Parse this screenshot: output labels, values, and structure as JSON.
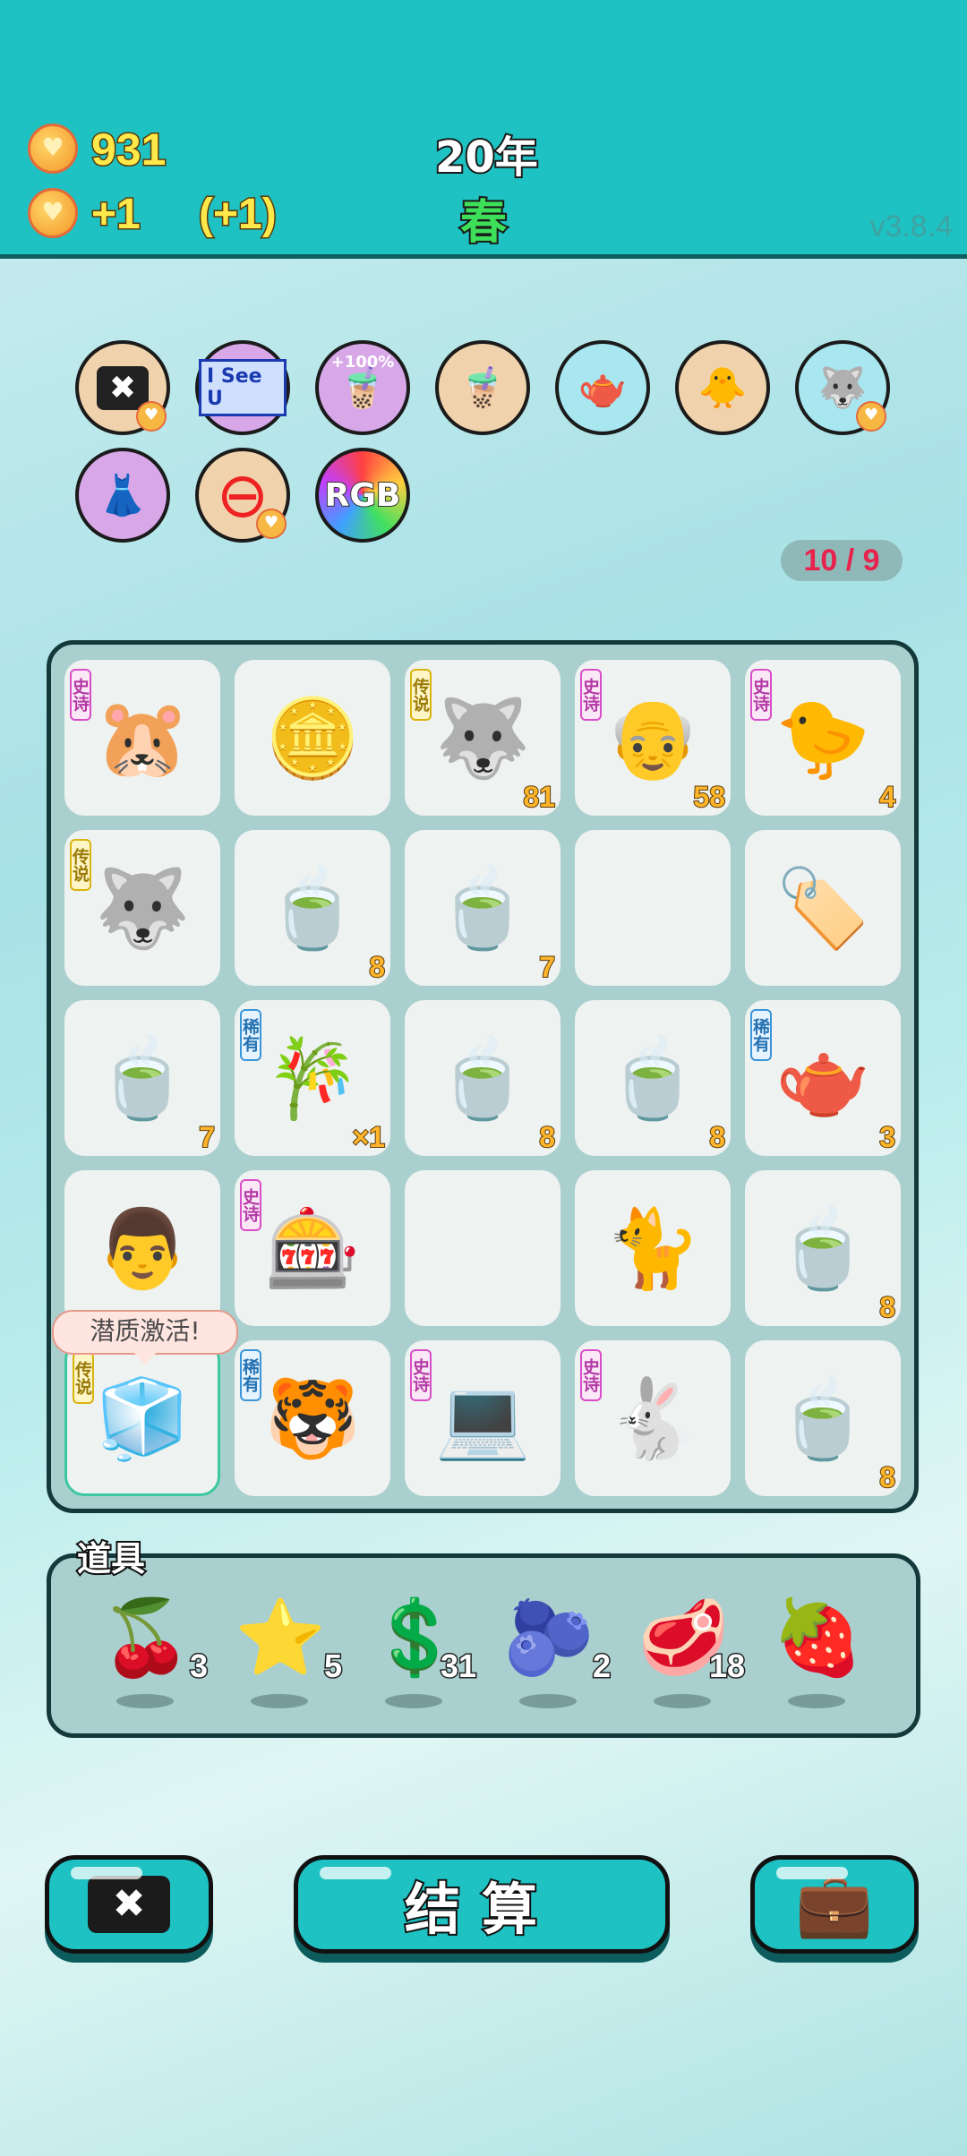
{
  "header": {
    "coins": "931",
    "income": "+1",
    "income_bonus": "(+1)",
    "year": "20年",
    "season": "春",
    "version": "v3.8.4"
  },
  "relics": [
    {
      "name": "remove-tag",
      "bg": "#f0d3ac",
      "glyph": "✖",
      "badge": true
    },
    {
      "name": "i-see-u",
      "bg": "#d8a7e8",
      "glyph": "I See U",
      "badge": false
    },
    {
      "name": "bubble-tea-100",
      "bg": "#d8a7e8",
      "glyph": "🧋",
      "label": "+100%",
      "badge": false
    },
    {
      "name": "bubble-tea",
      "bg": "#f0d3ac",
      "glyph": "🧋",
      "badge": false
    },
    {
      "name": "gravy-boat",
      "bg": "#a8e6f0",
      "glyph": "🫖",
      "badge": false
    },
    {
      "name": "chick-egg",
      "bg": "#f0d3ac",
      "glyph": "🐥",
      "badge": false
    },
    {
      "name": "husky",
      "bg": "#a8e6f0",
      "glyph": "🐺",
      "badge": true
    },
    {
      "name": "skirt",
      "bg": "#d8a7e8",
      "glyph": "👗",
      "badge": false
    },
    {
      "name": "minus",
      "bg": "#f0d3ac",
      "glyph": "⊖",
      "badge": true
    },
    {
      "name": "rgb",
      "bg": "#ff6a6a",
      "glyph": "RGB",
      "badge": false
    }
  ],
  "counter": "10 / 9",
  "board": [
    [
      {
        "icon": "🐹",
        "tag": "史诗",
        "tagType": "epic",
        "count": ""
      },
      {
        "icon": "🪙",
        "tag": "",
        "tagType": "",
        "count": ""
      },
      {
        "icon": "🐺",
        "tag": "传说",
        "tagType": "legend",
        "count": "81"
      },
      {
        "icon": "👴",
        "tag": "史诗",
        "tagType": "epic",
        "count": "58"
      },
      {
        "icon": "🐤",
        "tag": "史诗",
        "tagType": "epic",
        "count": "4"
      }
    ],
    [
      {
        "icon": "🐺",
        "tag": "传说",
        "tagType": "legend",
        "count": ""
      },
      {
        "icon": "🍵",
        "tag": "",
        "tagType": "",
        "count": "8"
      },
      {
        "icon": "🍵",
        "tag": "",
        "tagType": "",
        "count": "7"
      },
      {
        "icon": "",
        "tag": "",
        "tagType": "",
        "count": ""
      },
      {
        "icon": "🏷️",
        "tag": "",
        "tagType": "",
        "count": ""
      }
    ],
    [
      {
        "icon": "🍵",
        "tag": "",
        "tagType": "",
        "count": "7"
      },
      {
        "icon": "🎋",
        "tag": "稀有",
        "tagType": "rare",
        "count": "×1"
      },
      {
        "icon": "🍵",
        "tag": "",
        "tagType": "",
        "count": "8"
      },
      {
        "icon": "🍵",
        "tag": "",
        "tagType": "",
        "count": "8"
      },
      {
        "icon": "🫖",
        "tag": "稀有",
        "tagType": "rare",
        "count": "3"
      }
    ],
    [
      {
        "icon": "👨",
        "tag": "",
        "tagType": "",
        "count": ""
      },
      {
        "icon": "🎰",
        "tag": "史诗",
        "tagType": "epic",
        "count": ""
      },
      {
        "icon": "",
        "tag": "",
        "tagType": "",
        "count": ""
      },
      {
        "icon": "🐈",
        "tag": "",
        "tagType": "",
        "count": ""
      },
      {
        "icon": "🍵",
        "tag": "",
        "tagType": "",
        "count": "8"
      }
    ],
    [
      {
        "icon": "🧊",
        "tag": "传说",
        "tagType": "legend",
        "count": ""
      },
      {
        "icon": "🐯",
        "tag": "稀有",
        "tagType": "rare",
        "count": ""
      },
      {
        "icon": "💻",
        "tag": "史诗",
        "tagType": "epic",
        "count": ""
      },
      {
        "icon": "🐇",
        "tag": "史诗",
        "tagType": "epic",
        "count": ""
      },
      {
        "icon": "🍵",
        "tag": "",
        "tagType": "",
        "count": "8"
      }
    ]
  ],
  "tooltip": "潜质激活!",
  "items_title": "道具",
  "items": [
    {
      "icon": "🍒",
      "qty": "3",
      "name": "lychee"
    },
    {
      "icon": "⭐",
      "qty": "5",
      "name": "star"
    },
    {
      "icon": "💲",
      "qty": "31",
      "name": "dollar-coin"
    },
    {
      "icon": "🫐",
      "qty": "2",
      "name": "blueberry"
    },
    {
      "icon": "🥩",
      "qty": "18",
      "name": "liver"
    },
    {
      "icon": "🍓",
      "qty": "",
      "name": "strawberry"
    }
  ],
  "buttons": {
    "remove_icon": "✖",
    "settle": "结算",
    "bag_icon": "💼"
  },
  "colors": {
    "accent": "#1ec2c2",
    "coin_text": "#ffe84a",
    "season": "#3ee05a",
    "counter_text": "#e8224c"
  }
}
